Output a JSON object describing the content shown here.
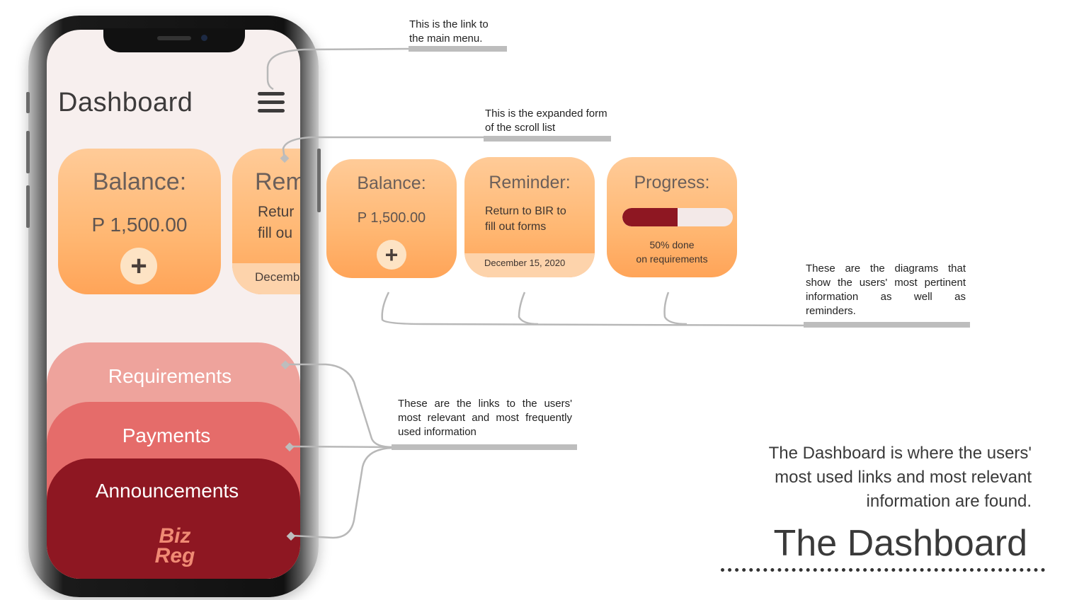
{
  "phone": {
    "title": "Dashboard",
    "menu_icon": "hamburger-menu-icon",
    "balance_card": {
      "title": "Balance:",
      "amount": "P 1,500.00"
    },
    "reminder_card_partial": {
      "title": "Rem",
      "line1": "Retur",
      "line2": "fill ou",
      "date": "Decemb"
    },
    "tabs": [
      {
        "label": "Requirements",
        "color": "#eea39c"
      },
      {
        "label": "Payments",
        "color": "#e56c6a"
      },
      {
        "label": "Announcements",
        "color": "#8e1722"
      }
    ],
    "logo": {
      "line1": "Biz",
      "line2": "Reg"
    }
  },
  "expanded": {
    "balance": {
      "title": "Balance:",
      "amount": "P 1,500.00"
    },
    "reminder": {
      "title": "Reminder:",
      "line1": "Return to BIR to",
      "line2": "fill out forms",
      "date": "December 15, 2020"
    },
    "progress": {
      "title": "Progress:",
      "percent": 50,
      "line1": "50% done",
      "line2": "on requirements"
    }
  },
  "annotations": {
    "menu_link": {
      "line1": "This is the link to",
      "line2": "the main menu."
    },
    "scroll_list": {
      "line1": "This is the expanded form",
      "line2": "of the scroll list"
    },
    "diagrams": {
      "line1": "These are the diagrams that",
      "line2": "show the users' most pertinent",
      "line3": "information as well as",
      "line4": "reminders."
    },
    "links": {
      "line1": "These are the links to the users'",
      "line2": "most relevant and most frequently",
      "line3": "used information"
    }
  },
  "caption": {
    "line1": "The Dashboard is where the users'",
    "line2": "most used links and most relevant",
    "line3": "information are found.",
    "heading": "The Dashboard"
  },
  "colors": {
    "card_orange": "#ffb772",
    "progress_fill": "#8e1722",
    "progress_track": "#f3e9e8",
    "annotation_bar": "#bdbdbd"
  }
}
